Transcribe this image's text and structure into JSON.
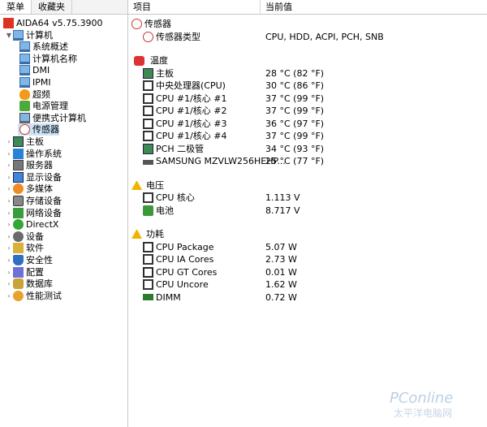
{
  "tabs": [
    "菜单",
    "收藏夹"
  ],
  "tree": [
    {
      "label": "AIDA64 v5.75.3900",
      "icon": "aida-icon",
      "indent": 0,
      "arrow": ""
    },
    {
      "label": "计算机",
      "icon": "computer-icon",
      "indent": 1,
      "arrow": "▼"
    },
    {
      "label": "系统概述",
      "icon": "monitor-icon",
      "indent": 2,
      "arrow": ""
    },
    {
      "label": "计算机名称",
      "icon": "monitor-icon",
      "indent": 2,
      "arrow": ""
    },
    {
      "label": "DMI",
      "icon": "monitor-icon",
      "indent": 2,
      "arrow": ""
    },
    {
      "label": "IPMI",
      "icon": "monitor-icon",
      "indent": 2,
      "arrow": ""
    },
    {
      "label": "超频",
      "icon": "fire-icon",
      "indent": 2,
      "arrow": ""
    },
    {
      "label": "电源管理",
      "icon": "leaf-icon",
      "indent": 2,
      "arrow": ""
    },
    {
      "label": "便携式计算机",
      "icon": "laptop-icon",
      "indent": 2,
      "arrow": ""
    },
    {
      "label": "传感器",
      "icon": "sensor-icon",
      "indent": 2,
      "arrow": "",
      "selected": true
    },
    {
      "label": "主板",
      "icon": "motherboard-icon",
      "indent": 1,
      "arrow": "›"
    },
    {
      "label": "操作系统",
      "icon": "windows-icon",
      "indent": 1,
      "arrow": "›"
    },
    {
      "label": "服务器",
      "icon": "server-icon",
      "indent": 1,
      "arrow": "›"
    },
    {
      "label": "显示设备",
      "icon": "display-icon",
      "indent": 1,
      "arrow": "›"
    },
    {
      "label": "多媒体",
      "icon": "media-icon",
      "indent": 1,
      "arrow": "›"
    },
    {
      "label": "存储设备",
      "icon": "storage-icon",
      "indent": 1,
      "arrow": "›"
    },
    {
      "label": "网络设备",
      "icon": "network-icon",
      "indent": 1,
      "arrow": "›"
    },
    {
      "label": "DirectX",
      "icon": "directx-icon",
      "indent": 1,
      "arrow": "›"
    },
    {
      "label": "设备",
      "icon": "devices-icon",
      "indent": 1,
      "arrow": "›"
    },
    {
      "label": "软件",
      "icon": "software-icon",
      "indent": 1,
      "arrow": "›"
    },
    {
      "label": "安全性",
      "icon": "security-icon",
      "indent": 1,
      "arrow": "›"
    },
    {
      "label": "配置",
      "icon": "config-icon",
      "indent": 1,
      "arrow": "›"
    },
    {
      "label": "数据库",
      "icon": "database-icon",
      "indent": 1,
      "arrow": "›"
    },
    {
      "label": "性能测试",
      "icon": "benchmark-icon",
      "indent": 1,
      "arrow": "›"
    }
  ],
  "header": {
    "col1": "项目",
    "col2": "当前值"
  },
  "sections": [
    {
      "title": "传感器",
      "icon": "sensor-icon",
      "rows": [
        {
          "label": "传感器类型",
          "icon": "sensor-icon",
          "value": "CPU, HDD, ACPI, PCH, SNB"
        }
      ]
    },
    {
      "title": "温度",
      "icon": "thermometer-icon",
      "rows": [
        {
          "label": "主板",
          "icon": "motherboard-icon",
          "value": "28 °C  (82 °F)"
        },
        {
          "label": "中央处理器(CPU)",
          "icon": "cpu-icon",
          "value": "30 °C  (86 °F)"
        },
        {
          "label": "CPU #1/核心 #1",
          "icon": "cpu-icon",
          "value": "37 °C  (99 °F)"
        },
        {
          "label": "CPU #1/核心 #2",
          "icon": "cpu-icon",
          "value": "37 °C  (99 °F)"
        },
        {
          "label": "CPU #1/核心 #3",
          "icon": "cpu-icon",
          "value": "36 °C  (97 °F)"
        },
        {
          "label": "CPU #1/核心 #4",
          "icon": "cpu-icon",
          "value": "37 °C  (99 °F)"
        },
        {
          "label": "PCH 二极管",
          "icon": "chip-icon",
          "value": "34 °C  (93 °F)"
        },
        {
          "label": "SAMSUNG MZVLW256HEHP...",
          "icon": "ssd-icon",
          "value": "25 °C  (77 °F)"
        }
      ]
    },
    {
      "title": "电压",
      "icon": "warning-icon",
      "rows": [
        {
          "label": "CPU 核心",
          "icon": "cpu-icon",
          "value": "1.113 V"
        },
        {
          "label": "电池",
          "icon": "battery-icon",
          "value": "8.717 V"
        }
      ]
    },
    {
      "title": "功耗",
      "icon": "warning-icon",
      "rows": [
        {
          "label": "CPU Package",
          "icon": "cpu-icon",
          "value": "5.07 W"
        },
        {
          "label": "CPU IA Cores",
          "icon": "cpu-icon",
          "value": "2.73 W"
        },
        {
          "label": "CPU GT Cores",
          "icon": "gpu-icon",
          "value": "0.01 W"
        },
        {
          "label": "CPU Uncore",
          "icon": "cpu-icon",
          "value": "1.62 W"
        },
        {
          "label": "DIMM",
          "icon": "memory-icon",
          "value": "0.72 W"
        }
      ]
    }
  ],
  "watermark": "PConline",
  "watermark_sub": "太平洋电脑网"
}
